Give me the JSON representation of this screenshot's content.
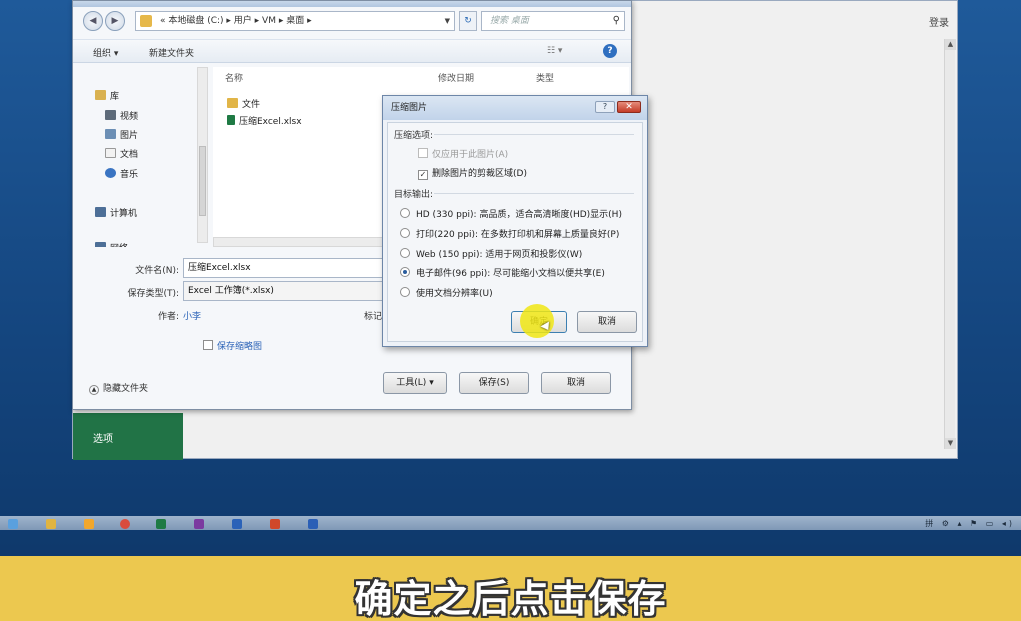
{
  "excel": {
    "login_label": "登录",
    "options_label": "选项"
  },
  "save_dialog": {
    "address_path": "« 本地磁盘 (C:) ▸ 用户 ▸ VM ▸ 桌面 ▸",
    "search_placeholder": "搜索 桌面",
    "toolbar": {
      "organize": "组织 ▾",
      "new_folder": "新建文件夹",
      "views": "☷ ▾"
    },
    "nav_items": [
      {
        "label": "库",
        "icon": "library-icon"
      },
      {
        "label": "视频",
        "icon": "video-icon"
      },
      {
        "label": "图片",
        "icon": "picture-icon"
      },
      {
        "label": "文档",
        "icon": "document-icon"
      },
      {
        "label": "音乐",
        "icon": "music-icon"
      },
      {
        "label": "计算机",
        "icon": "computer-icon"
      },
      {
        "label": "网络",
        "icon": "network-icon"
      }
    ],
    "columns": [
      "名称",
      "修改日期",
      "类型"
    ],
    "files": [
      {
        "name": "文件",
        "icon": "folder-icon"
      },
      {
        "name": "压缩Excel.xlsx",
        "icon": "excel-file-icon"
      }
    ],
    "filename_label": "文件名(N):",
    "filename_value": "压缩Excel.xlsx",
    "filetype_label": "保存类型(T):",
    "filetype_value": "Excel 工作簿(*.xlsx)",
    "author_label": "作者:",
    "author_value": "小李",
    "tags_label": "标记",
    "thumbnail_label": "保存缩略图",
    "hide_folders_label": "隐藏文件夹",
    "tools_label": "工具(L)",
    "save_label": "保存(S)",
    "cancel_label": "取消"
  },
  "compress_dialog": {
    "title": "压缩图片",
    "help": "?",
    "close": "✕",
    "section_options": "压缩选项:",
    "opt_apply_only": "仅应用于此图片(A)",
    "opt_delete_cropped": "删除图片的剪裁区域(D)",
    "section_output": "目标输出:",
    "res_hd": "HD (330 ppi): 高品质，适合高清晰度(HD)显示(H)",
    "res_print": "打印(220 ppi): 在多数打印机和屏幕上质量良好(P)",
    "res_web": "Web (150 ppi): 适用于网页和投影仪(W)",
    "res_email": "电子邮件(96 ppi): 尽可能缩小文档以便共享(E)",
    "res_doc": "使用文档分辨率(U)",
    "selected_resolution": "email",
    "ok_label": "确定",
    "cancel_label": "取消"
  },
  "taskbar": {
    "tray_text": "拼 ⚙ ▴ ⚑ ▭ ◂)"
  },
  "subtitle": "确定之后点击保存"
}
